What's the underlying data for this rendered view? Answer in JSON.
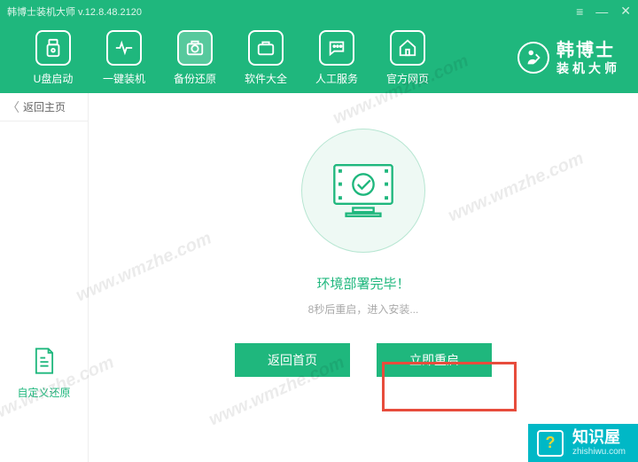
{
  "app": {
    "title": "韩博士装机大师 v.12.8.48.2120"
  },
  "win": {
    "menu": "≡",
    "min": "—",
    "close": "✕"
  },
  "nav": [
    {
      "label": "U盘启动"
    },
    {
      "label": "一键装机"
    },
    {
      "label": "备份还原"
    },
    {
      "label": "软件大全"
    },
    {
      "label": "人工服务"
    },
    {
      "label": "官方网页"
    }
  ],
  "brand": {
    "cn": "韩博士",
    "sub": "装机大师"
  },
  "back": "返回主页",
  "sidebar_custom": "自定义还原",
  "status": "环境部署完毕！",
  "countdown": "8秒后重启，进入安装...",
  "buttons": {
    "home": "返回首页",
    "restart": "立即重启"
  },
  "zsw": {
    "cn": "知识屋",
    "url": "zhishiwu.com"
  },
  "watermark": "www.wmzhe.com"
}
